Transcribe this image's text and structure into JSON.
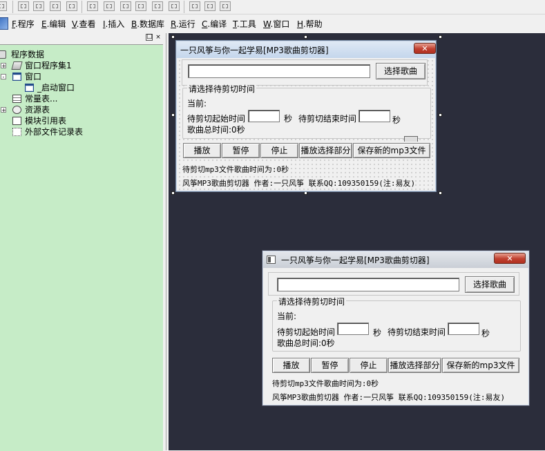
{
  "menu": [
    {
      "key": "F",
      "label": ".程序"
    },
    {
      "key": "E",
      "label": ".编辑"
    },
    {
      "key": "V",
      "label": ".查看"
    },
    {
      "key": "I",
      "label": ".插入"
    },
    {
      "key": "B",
      "label": ".数据库"
    },
    {
      "key": "R",
      "label": ".运行"
    },
    {
      "key": "C",
      "label": ".编译"
    },
    {
      "key": "T",
      "label": ".工具"
    },
    {
      "key": "W",
      "label": ".窗口"
    },
    {
      "key": "H",
      "label": ".帮助"
    }
  ],
  "panel": {
    "restore_glyph": "□",
    "close_glyph": "×"
  },
  "tree": {
    "root": "程序数据",
    "items": [
      "窗口程序集1",
      "窗口",
      "_启动窗口",
      "常量表...",
      "资源表",
      "模块引用表",
      "外部文件记录表"
    ],
    "expand_glyph": "+",
    "collapse_glyph": "-"
  },
  "form": {
    "title": "一只风筝与你一起学易[MP3歌曲剪切器]",
    "close_glyph": "✕",
    "choose_song": "选择歌曲",
    "group_label": "请选择待剪切时间",
    "current": "当前:",
    "start_label": "待剪切起始时间",
    "seconds": "秒",
    "end_label": "待剪切结束时间",
    "total_time": "歌曲总时间:0秒",
    "buttons": [
      "播放",
      "暂停",
      "停止",
      "播放选择部分",
      "保存新的mp3文件"
    ],
    "cut_time": "待剪切mp3文件歌曲时间为:0秒",
    "footer": "风筝MP3歌曲剪切器 作者:一只风筝 联系QQ:109350159(注:易友)"
  }
}
